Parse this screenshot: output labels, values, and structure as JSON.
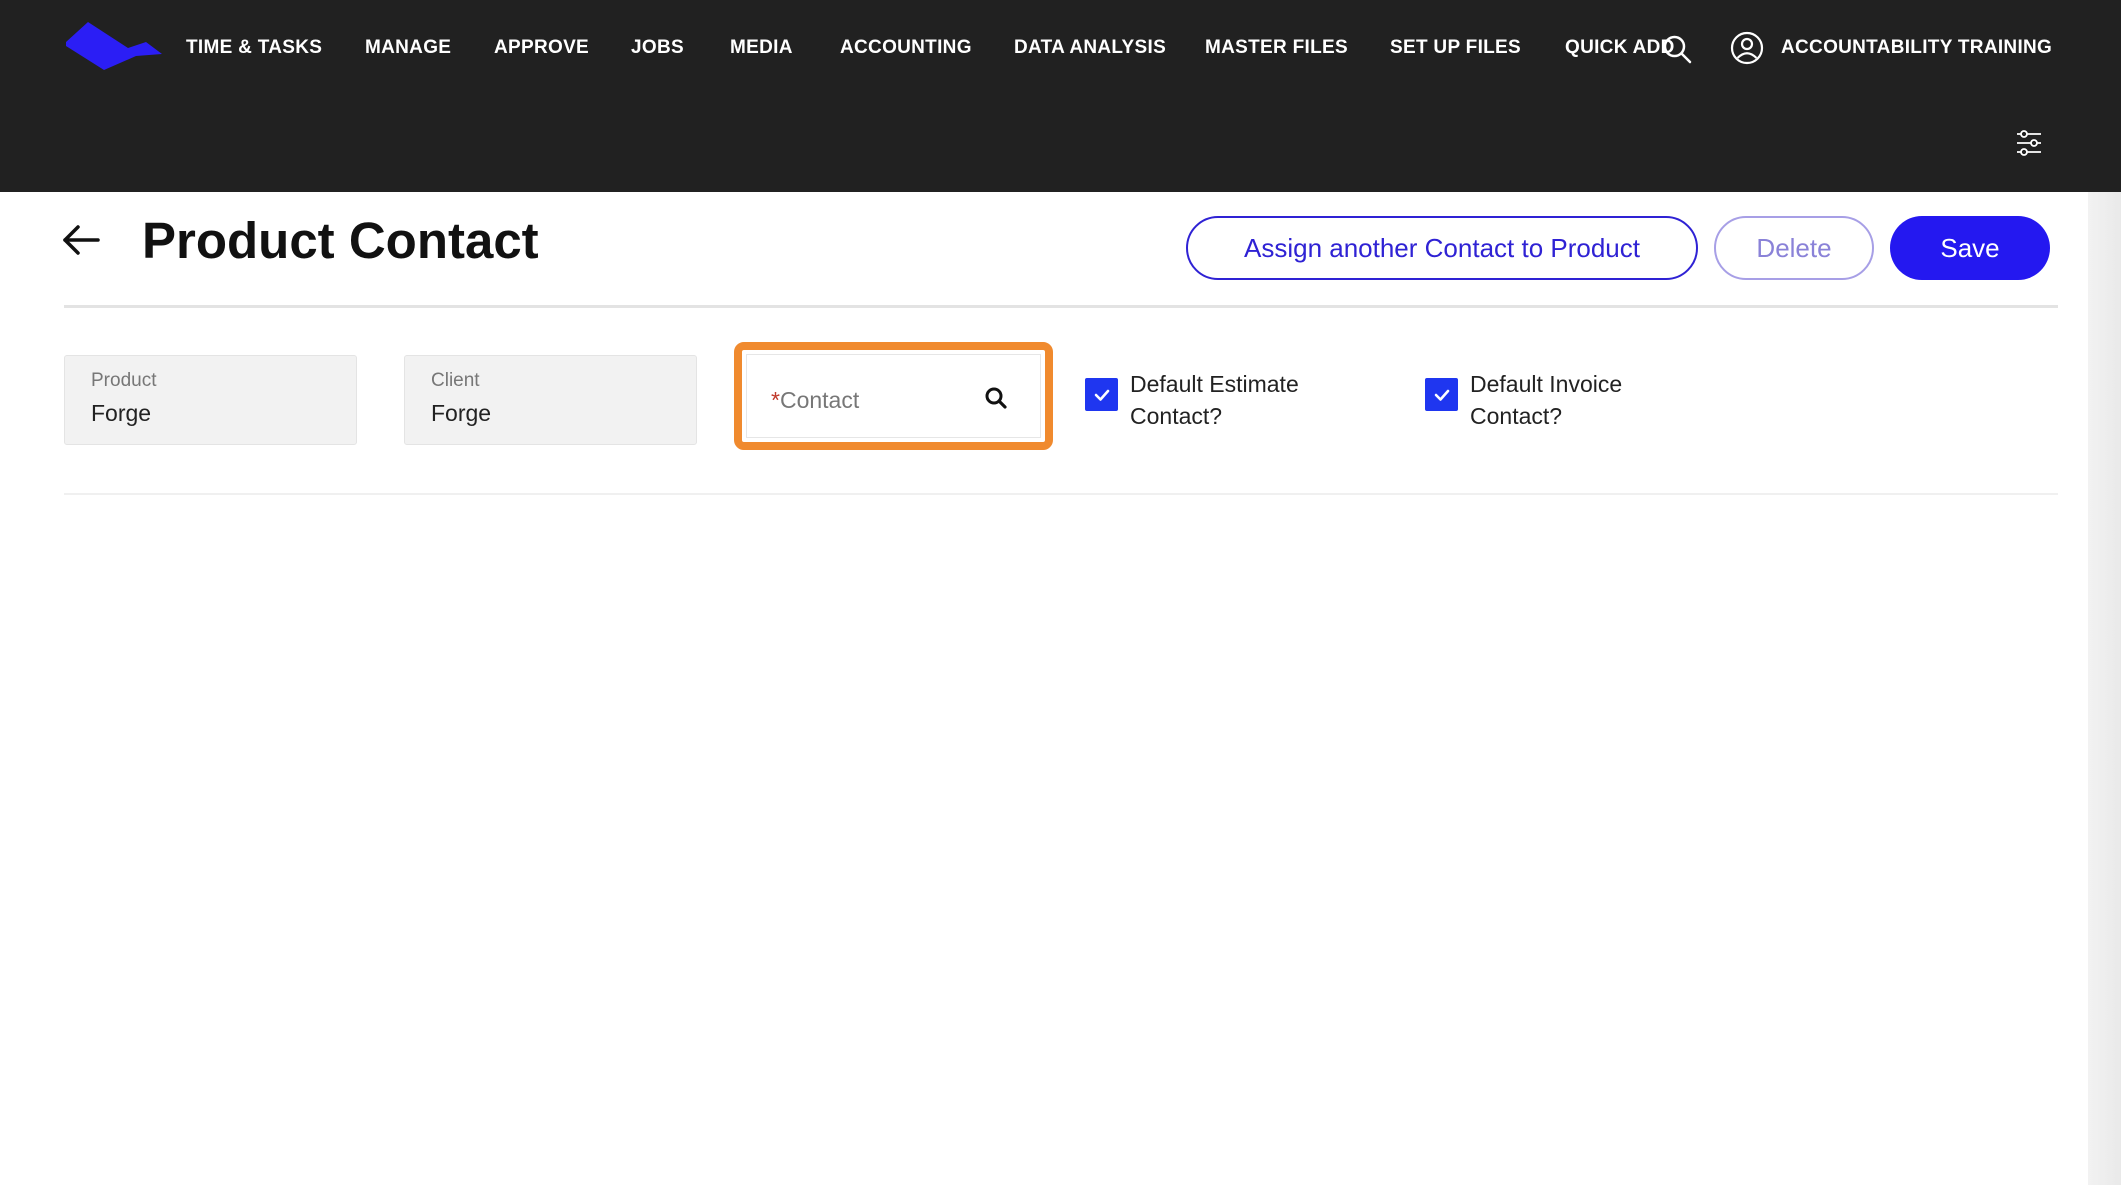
{
  "nav": {
    "items": [
      {
        "label": "TIME & TASKS"
      },
      {
        "label": "MANAGE"
      },
      {
        "label": "APPROVE"
      },
      {
        "label": "JOBS"
      },
      {
        "label": "MEDIA"
      },
      {
        "label": "ACCOUNTING"
      },
      {
        "label": "DATA ANALYSIS"
      },
      {
        "label": "MASTER FILES"
      },
      {
        "label": "SET UP FILES"
      },
      {
        "label": "QUICK ADD"
      }
    ],
    "search_icon": "search-icon",
    "account": {
      "icon": "user-circle-icon",
      "name": "ACCOUNTABILITY TRAINING"
    },
    "settings_icon": "sliders-icon"
  },
  "header": {
    "back_icon": "arrow-left-icon",
    "title": "Product Contact",
    "buttons": {
      "assign": "Assign another Contact to Product",
      "delete": "Delete",
      "save": "Save"
    }
  },
  "form": {
    "product": {
      "label": "Product",
      "value": "Forge"
    },
    "client": {
      "label": "Client",
      "value": "Forge"
    },
    "contact": {
      "required_mark": "*",
      "placeholder": "Contact",
      "value": ""
    },
    "default_estimate": {
      "label": "Default Estimate Contact?",
      "checked": true
    },
    "default_invoice": {
      "label": "Default Invoice Contact?",
      "checked": true
    }
  },
  "colors": {
    "topbar": "#212121",
    "brand": "#2418f0",
    "highlight": "#f08a2e",
    "checkbox": "#1f36f0"
  }
}
